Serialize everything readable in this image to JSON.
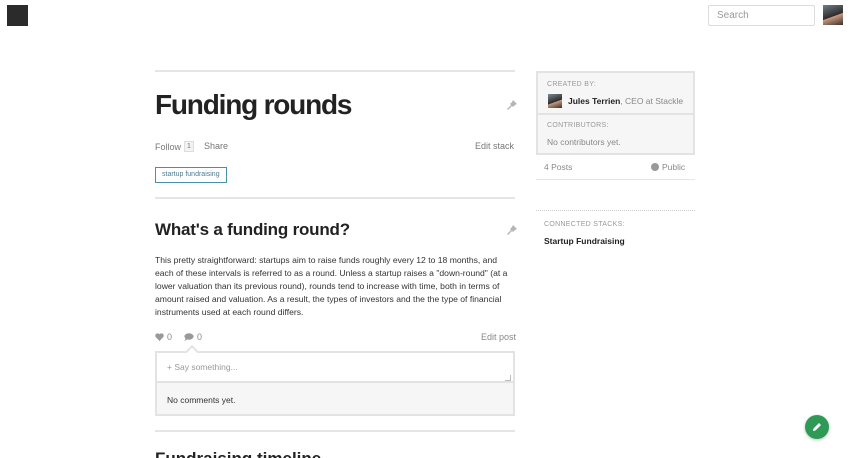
{
  "header": {
    "search_placeholder": "Search",
    "logo_icon": "square-logo-icon",
    "avatar_icon": "user-avatar"
  },
  "stack": {
    "title": "Funding rounds",
    "follow_label": "Follow",
    "follow_count": "1",
    "share_label": "Share",
    "edit_label": "Edit stack",
    "tags": [
      "startup fundraising"
    ]
  },
  "post": {
    "title": "What's a funding round?",
    "body": "This pretty straightforward: startups aim to raise funds roughly every 12 to 18 months, and each of these intervals is referred to as a round. Unless a startup raises a \"down-round\" (at a lower valuation than its previous round), rounds tend to increase with time, both in terms of amount raised and valuation. As a result, the types of investors and the the type of financial instruments used at each round differs.",
    "likes": "0",
    "comments": "0",
    "edit_label": "Edit post",
    "comment_placeholder": "+ Say something...",
    "no_comments": "No comments yet."
  },
  "next_post": {
    "title": "Fundraising timeline"
  },
  "sidebar": {
    "created_by_label": "CREATED BY:",
    "creator_name": "Jules Terrien",
    "creator_role": ", CEO at Stackle",
    "contributors_label": "CONTRIBUTORS:",
    "no_contributors": "No contributors yet.",
    "posts_count": "4 Posts",
    "visibility": "Public",
    "connected_label": "CONNECTED STACKS:",
    "connected": [
      "Startup Fundraising"
    ]
  },
  "colors": {
    "accent_green": "#2e9a55",
    "tag_border": "#4b8faa"
  }
}
